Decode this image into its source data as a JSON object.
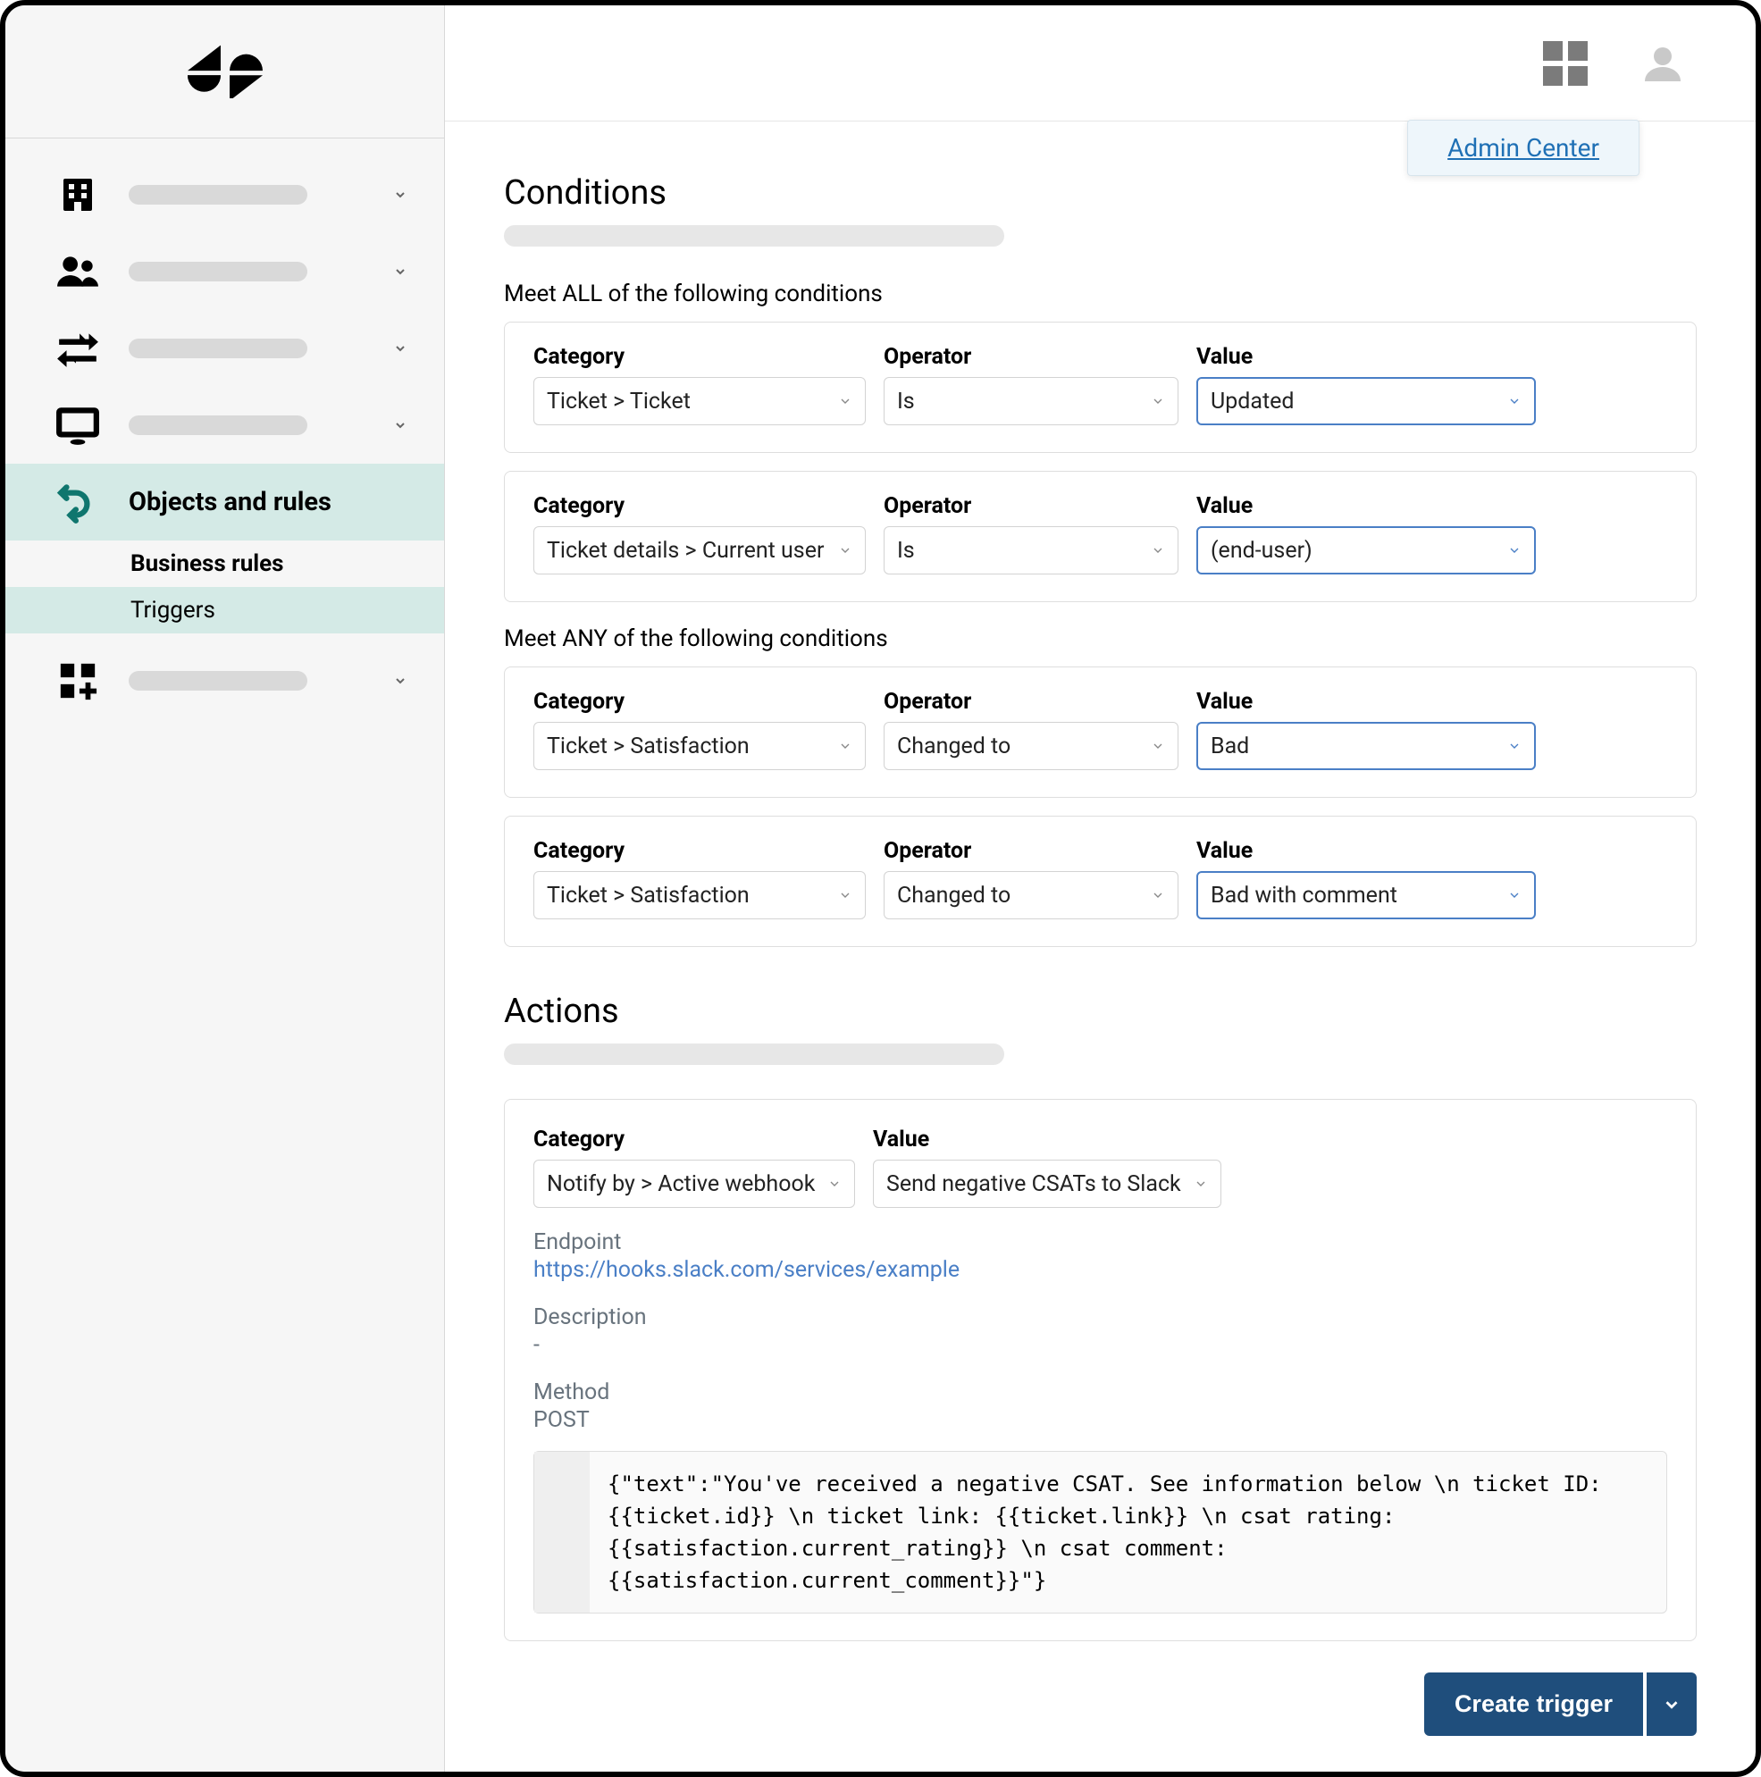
{
  "popover": {
    "admin_center": "Admin Center"
  },
  "sidebar": {
    "objects_and_rules": "Objects and rules",
    "business_rules": "Business rules",
    "triggers": "Triggers"
  },
  "sections": {
    "conditions_title": "Conditions",
    "actions_title": "Actions",
    "meet_all": "Meet ALL of the following conditions",
    "meet_any": "Meet ANY of the following conditions"
  },
  "labels": {
    "category": "Category",
    "operator": "Operator",
    "value": "Value"
  },
  "conditions_all": [
    {
      "category": "Ticket > Ticket",
      "operator": "Is",
      "value": "Updated"
    },
    {
      "category": "Ticket details > Current user",
      "operator": "Is",
      "value": "(end-user)"
    }
  ],
  "conditions_any": [
    {
      "category": "Ticket > Satisfaction",
      "operator": "Changed to",
      "value": "Bad"
    },
    {
      "category": "Ticket > Satisfaction",
      "operator": "Changed to",
      "value": "Bad with comment"
    }
  ],
  "action": {
    "category": "Notify by > Active webhook",
    "value": "Send negative CSATs to Slack",
    "endpoint_label": "Endpoint",
    "endpoint": "https://hooks.slack.com/services/example",
    "description_label": "Description",
    "description": "-",
    "method_label": "Method",
    "method": "POST",
    "body": "{\"text\":\"You've received a negative CSAT. See information below \\n ticket ID: {{ticket.id}} \\n ticket link: {{ticket.link}} \\n csat rating: {{satisfaction.current_rating}} \\n csat comment: {{satisfaction.current_comment}}\"}"
  },
  "footer": {
    "create_trigger": "Create trigger"
  }
}
